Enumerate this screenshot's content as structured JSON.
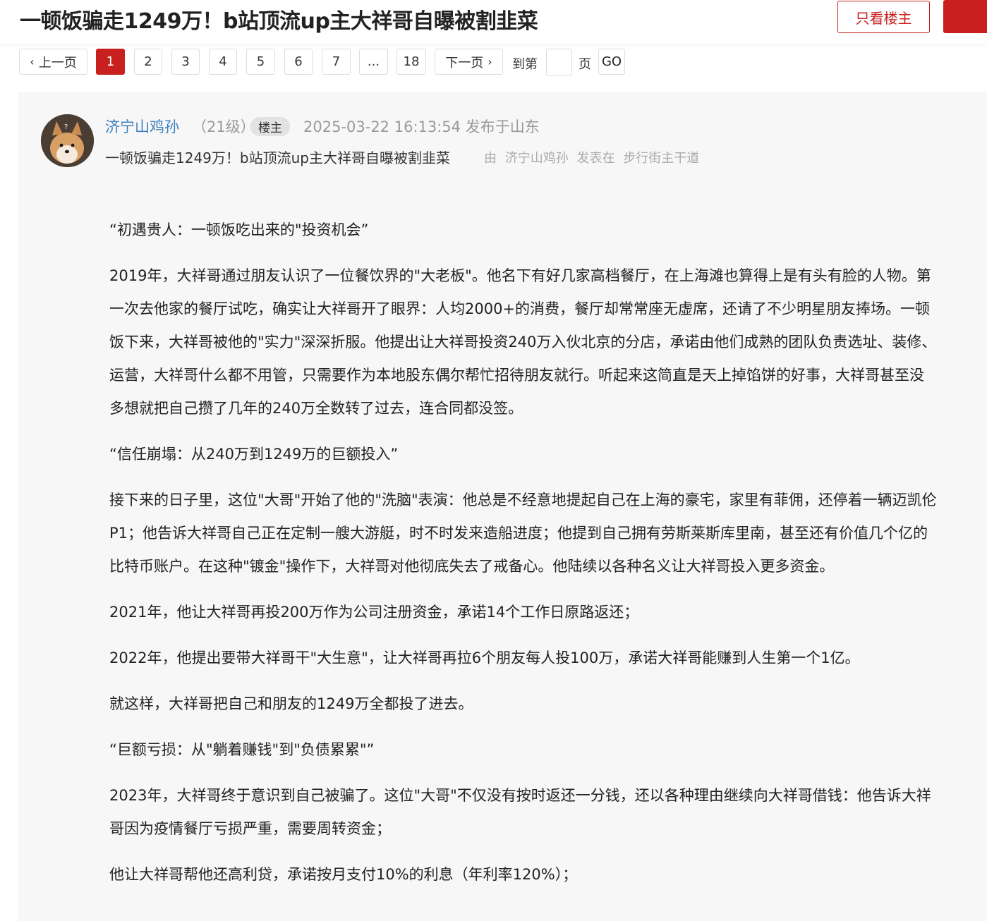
{
  "header": {
    "title": "一顿饭骗走1249万！b站顶流up主大祥哥自曝被割韭菜",
    "only_op_label": "只看楼主"
  },
  "pagination": {
    "prev_label": "上一页",
    "pages": [
      "1",
      "2",
      "3",
      "4",
      "5",
      "6",
      "7",
      "...",
      "18"
    ],
    "active_page": "1",
    "next_label": "下一页",
    "goto_label": "到第",
    "page_unit": "页",
    "go_label": "GO"
  },
  "post": {
    "author": "济宁山鸡孙",
    "level": "（21级）",
    "op_badge": "楼主",
    "timestamp": "2025-03-22 16:13:54",
    "location": "发布于山东",
    "subject": "一顿饭骗走1249万！b站顶流up主大祥哥自曝被割韭菜",
    "by_label": "由",
    "by_author": "济宁山鸡孙",
    "posted_in_label": "发表在",
    "board": "步行街主干道",
    "paragraphs": [
      "“初遇贵人：一顿饭吃出来的\"投资机会”",
      "2019年，大祥哥通过朋友认识了一位餐饮界的\"大老板\"。他名下有好几家高档餐厅，在上海滩也算得上是有头有脸的人物。第一次去他家的餐厅试吃，确实让大祥哥开了眼界：人均2000+的消费，餐厅却常常座无虚席，还请了不少明星朋友捧场。一顿饭下来，大祥哥被他的\"实力\"深深折服。他提出让大祥哥投资240万入伙北京的分店，承诺由他们成熟的团队负责选址、装修、运营，大祥哥什么都不用管，只需要作为本地股东偶尔帮忙招待朋友就行。听起来这简直是天上掉馅饼的好事，大祥哥甚至没多想就把自己攒了几年的240万全数转了过去，连合同都没签。",
      "“信任崩塌：从240万到1249万的巨额投入”",
      "接下来的日子里，这位\"大哥\"开始了他的\"洗脑\"表演：他总是不经意地提起自己在上海的豪宅，家里有菲佣，还停着一辆迈凯伦P1；他告诉大祥哥自己正在定制一艘大游艇，时不时发来造船进度；他提到自己拥有劳斯莱斯库里南，甚至还有价值几个亿的比特币账户。在这种\"镀金\"操作下，大祥哥对他彻底失去了戒备心。他陆续以各种名义让大祥哥投入更多资金。",
      "2021年，他让大祥哥再投200万作为公司注册资金，承诺14个工作日原路返还；",
      "2022年，他提出要带大祥哥干\"大生意\"，让大祥哥再拉6个朋友每人投100万，承诺大祥哥能赚到人生第一个1亿。",
      "就这样，大祥哥把自己和朋友的1249万全都投了进去。",
      "“巨额亏损：从\"躺着赚钱\"到\"负债累累\"”",
      "2023年，大祥哥终于意识到自己被骗了。这位\"大哥\"不仅没有按时返还一分钱，还以各种理由继续向大祥哥借钱：他告诉大祥哥因为疫情餐厅亏损严重，需要周转资金；",
      "他让大祥哥帮他还高利贷，承诺按月支付10%的利息（年利率120%）；"
    ]
  },
  "colors": {
    "accent": "#c81f1f",
    "link": "#3e7fc1",
    "muted": "#999999",
    "card_bg": "#f7f7f7"
  }
}
